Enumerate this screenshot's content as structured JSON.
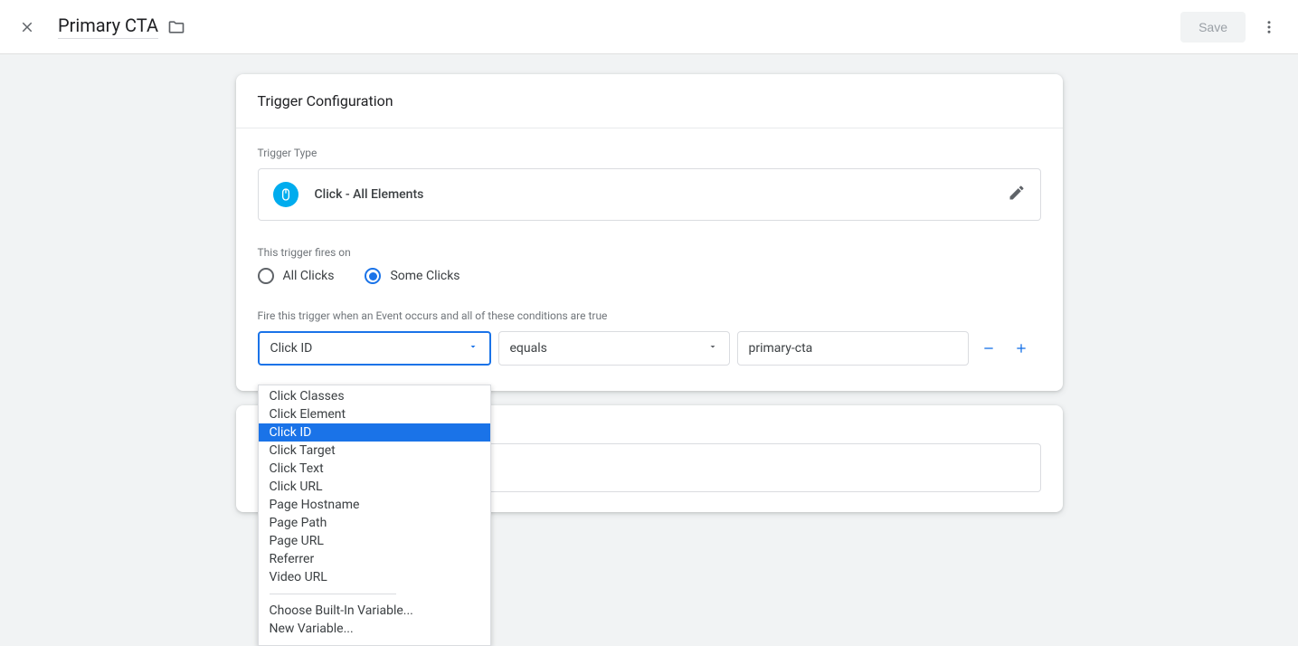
{
  "header": {
    "title": "Primary CTA",
    "save_label": "Save"
  },
  "card": {
    "heading": "Trigger Configuration",
    "trigger_type_label": "Trigger Type",
    "trigger_type_name": "Click - All Elements",
    "fires_on_label": "This trigger fires on",
    "radio_all": "All Clicks",
    "radio_some": "Some Clicks",
    "condition_intro": "Fire this trigger when an Event occurs and all of these conditions are true",
    "variable_sel": "Click ID",
    "operator_sel": "equals",
    "value_sel": "primary-cta"
  },
  "dropdown": {
    "items": [
      "Click Classes",
      "Click Element",
      "Click ID",
      "Click Target",
      "Click Text",
      "Click URL",
      "Page Hostname",
      "Page Path",
      "Page URL",
      "Referrer",
      "Video URL"
    ],
    "selected": "Click ID",
    "builtin": "Choose Built-In Variable...",
    "newvar": "New Variable..."
  }
}
